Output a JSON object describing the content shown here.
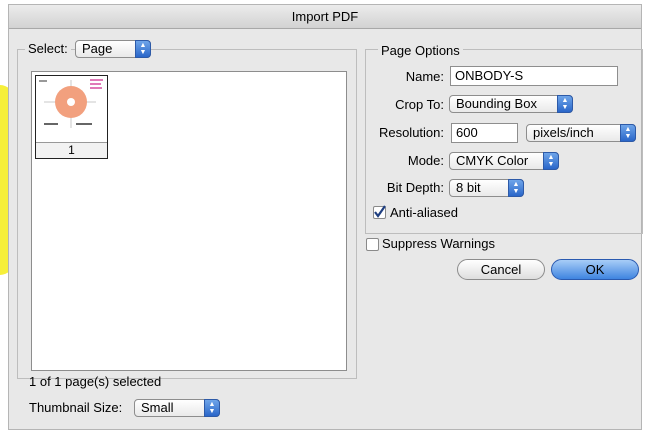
{
  "window": {
    "title": "Import PDF"
  },
  "select": {
    "label": "Select:",
    "value": "Page"
  },
  "thumbnail": {
    "page_number": "1"
  },
  "status": {
    "selected_text": "1 of 1 page(s) selected"
  },
  "thumbnail_size": {
    "label": "Thumbnail Size:",
    "value": "Small"
  },
  "page_options": {
    "legend": "Page Options",
    "name_label": "Name:",
    "name_value": "ONBODY-S",
    "crop_label": "Crop To:",
    "crop_value": "Bounding Box",
    "resolution_label": "Resolution:",
    "resolution_value": "600",
    "resolution_unit": "pixels/inch",
    "mode_label": "Mode:",
    "mode_value": "CMYK Color",
    "bitdepth_label": "Bit Depth:",
    "bitdepth_value": "8 bit",
    "antialias_label": "Anti-aliased",
    "antialias_checked": true
  },
  "suppress": {
    "label": "Suppress Warnings",
    "checked": false
  },
  "buttons": {
    "cancel": "Cancel",
    "ok": "OK"
  },
  "icons": {
    "popup_arrows": "popup-arrows-icon",
    "checkmark": "checkmark-icon"
  },
  "colors": {
    "accent": "#2a66c9",
    "thumbnail_circle": "#f2a07e",
    "highlight": "#f6ef3a"
  }
}
